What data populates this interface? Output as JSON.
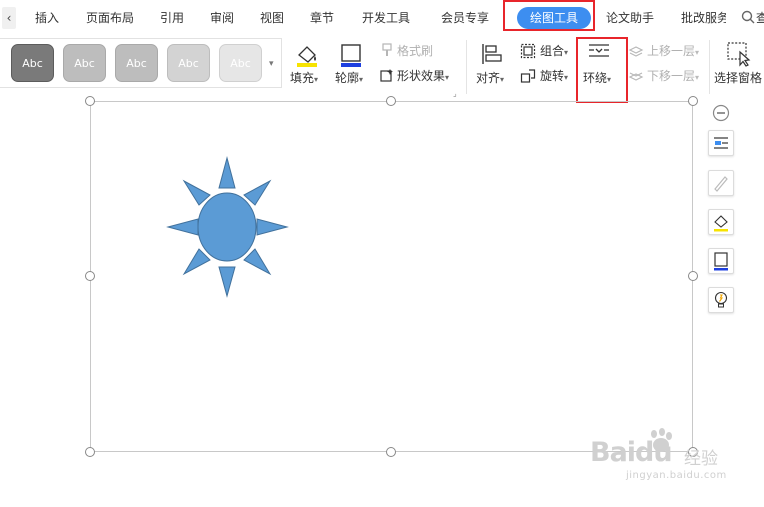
{
  "tabs": [
    {
      "label": "插入"
    },
    {
      "label": "页面布局"
    },
    {
      "label": "引用"
    },
    {
      "label": "审阅"
    },
    {
      "label": "视图"
    },
    {
      "label": "章节"
    },
    {
      "label": "开发工具"
    },
    {
      "label": "会员专享"
    },
    {
      "label": "绘图工具",
      "active": true
    },
    {
      "label": "论文助手"
    },
    {
      "label": "批改服务"
    }
  ],
  "scroll_left_glyph": "‹",
  "search_glyph": "查",
  "styles": {
    "swatches": [
      "Abc",
      "Abc",
      "Abc",
      "Abc",
      "Abc"
    ],
    "more_glyph": "▾"
  },
  "ribbon": {
    "fill": "填充",
    "outline": "轮廓",
    "format_painter": "格式刷",
    "shape_effects": "形状效果",
    "align": "对齐",
    "group": "组合",
    "rotate": "旋转",
    "wrap": "环绕",
    "bring_forward": "上移一层",
    "send_backward": "下移一层",
    "selection_pane": "选择窗格"
  },
  "colors": {
    "accent": "#3d8ef0",
    "highlight_box": "#e8252b",
    "sun_fill": "#5b9bd5",
    "sun_stroke": "#41719c"
  },
  "watermark": {
    "brand": "Baidu",
    "sub": "经验",
    "url": "jingyan.baidu.com"
  }
}
